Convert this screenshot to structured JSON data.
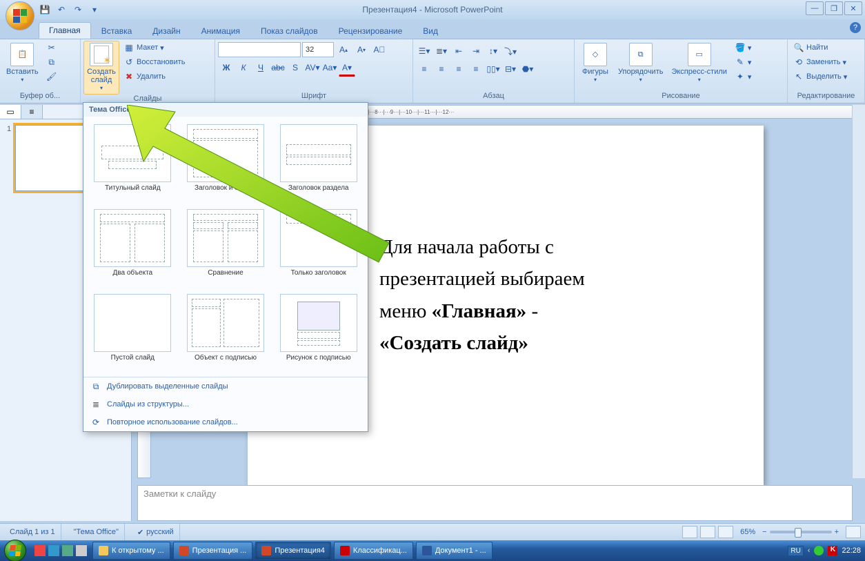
{
  "titlebar": {
    "title": "Презентация4 - Microsoft PowerPoint"
  },
  "tabs": [
    "Главная",
    "Вставка",
    "Дизайн",
    "Анимация",
    "Показ слайдов",
    "Рецензирование",
    "Вид"
  ],
  "active_tab": "Главная",
  "ribbon": {
    "clipboard": {
      "label": "Буфер об...",
      "paste": "Вставить"
    },
    "slides": {
      "label": "Слайды",
      "new_slide": "Создать\nслайд",
      "layout": "Макет",
      "reset": "Восстановить",
      "delete": "Удалить"
    },
    "font": {
      "label": "Шрифт",
      "size": "32"
    },
    "paragraph": {
      "label": "Абзац"
    },
    "drawing": {
      "label": "Рисование",
      "shapes": "Фигуры",
      "arrange": "Упорядочить",
      "quick": "Экспресс-стили"
    },
    "editing": {
      "label": "Редактирование",
      "find": "Найти",
      "replace": "Заменить",
      "select": "Выделить"
    }
  },
  "gallery": {
    "header": "Тема Office",
    "layouts": [
      "Титульный слайд",
      "Заголовок и объект",
      "Заголовок раздела",
      "Два объекта",
      "Сравнение",
      "Только заголовок",
      "Пустой слайд",
      "Объект с подписью",
      "Рисунок с подписью"
    ],
    "footer": [
      "Дублировать выделенные слайды",
      "Слайды из структуры...",
      "Повторное использование слайдов..."
    ]
  },
  "annotation": {
    "line1": "Для начала работы с",
    "line2": "презентацией выбираем",
    "line3": "меню «Главная» -",
    "line4": "«Создать слайд»"
  },
  "notes_placeholder": "Заметки к слайду",
  "status": {
    "slide": "Слайд 1 из 1",
    "theme": "\"Тема Office\"",
    "lang": "русский",
    "zoom": "65%"
  },
  "taskbar": {
    "tasks": [
      "К открытому ...",
      "Презентация ...",
      "Презентация4",
      "Классификац...",
      "Документ1 - ..."
    ],
    "lang": "RU",
    "clock": "22:28"
  },
  "ruler_marks": "···6···|···5···|···4···|···3···|···2···|···1···|···0···|···1···|···2···|···3···|···4···|···5···|···6···|···7···|···8···|···9···|···10···|···11···|···12···"
}
